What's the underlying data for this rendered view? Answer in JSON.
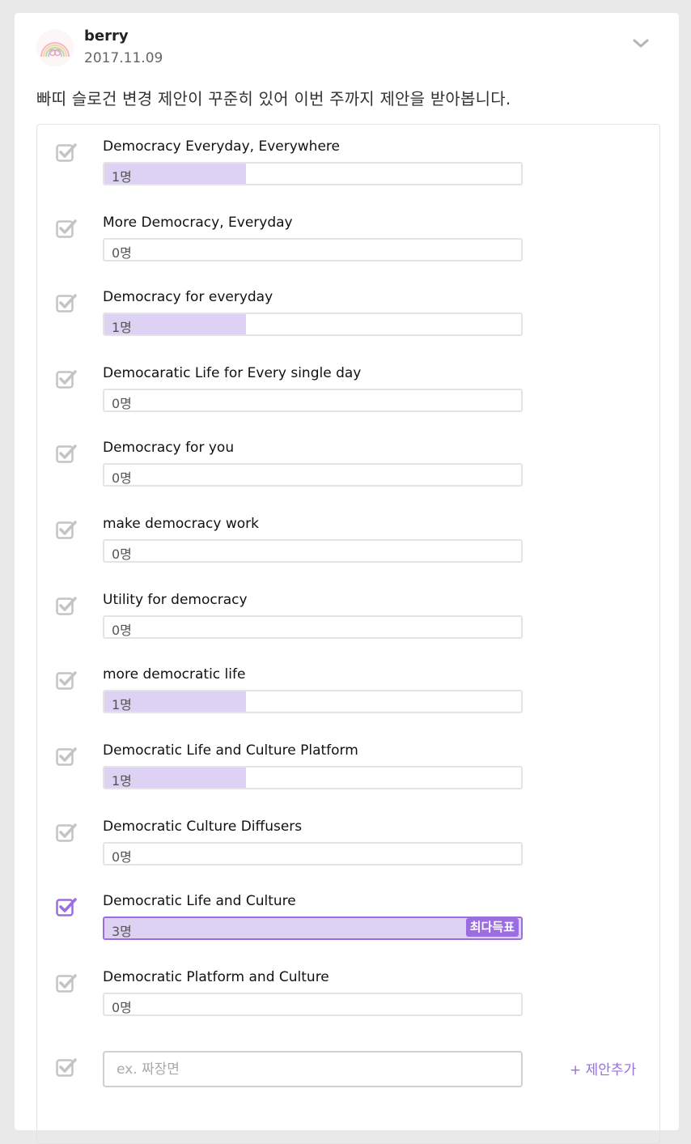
{
  "post": {
    "author": "berry",
    "date": "2017.11.09",
    "text": "빠띠 슬로건 변경 제안이 꾸준히 있어 이번 주까지 제안을 받아봅니다."
  },
  "poll": {
    "options": [
      {
        "label": "Democracy Everyday, Everywhere",
        "count": "1명",
        "share": 0.34,
        "checked": false
      },
      {
        "label": "More Democracy, Everyday",
        "count": "0명",
        "share": 0,
        "checked": false
      },
      {
        "label": "Democracy for everyday",
        "count": "1명",
        "share": 0.34,
        "checked": false
      },
      {
        "label": "Democaratic Life for Every single day",
        "count": "0명",
        "share": 0,
        "checked": false
      },
      {
        "label": "Democracy for you",
        "count": "0명",
        "share": 0,
        "checked": false
      },
      {
        "label": "make democracy work",
        "count": "0명",
        "share": 0,
        "checked": false
      },
      {
        "label": "Utility for democracy",
        "count": "0명",
        "share": 0,
        "checked": false
      },
      {
        "label": "more democratic life",
        "count": "1명",
        "share": 0.34,
        "checked": false
      },
      {
        "label": "Democratic Life and Culture Platform",
        "count": "1명",
        "share": 0.34,
        "checked": false
      },
      {
        "label": "Democratic Culture Diffusers",
        "count": "0명",
        "share": 0,
        "checked": false
      },
      {
        "label": "Democratic Life and Culture",
        "count": "3명",
        "share": 1.0,
        "checked": true,
        "badge": "최다득표"
      },
      {
        "label": "Democratic Platform and Culture",
        "count": "0명",
        "share": 0,
        "checked": false
      }
    ],
    "add_placeholder": "ex. 짜장면",
    "add_label": "+ 제안추가"
  },
  "colors": {
    "accent": "#9a6ee0",
    "fill": "#ddd2f3",
    "check_inactive": "#c4c4c4"
  }
}
